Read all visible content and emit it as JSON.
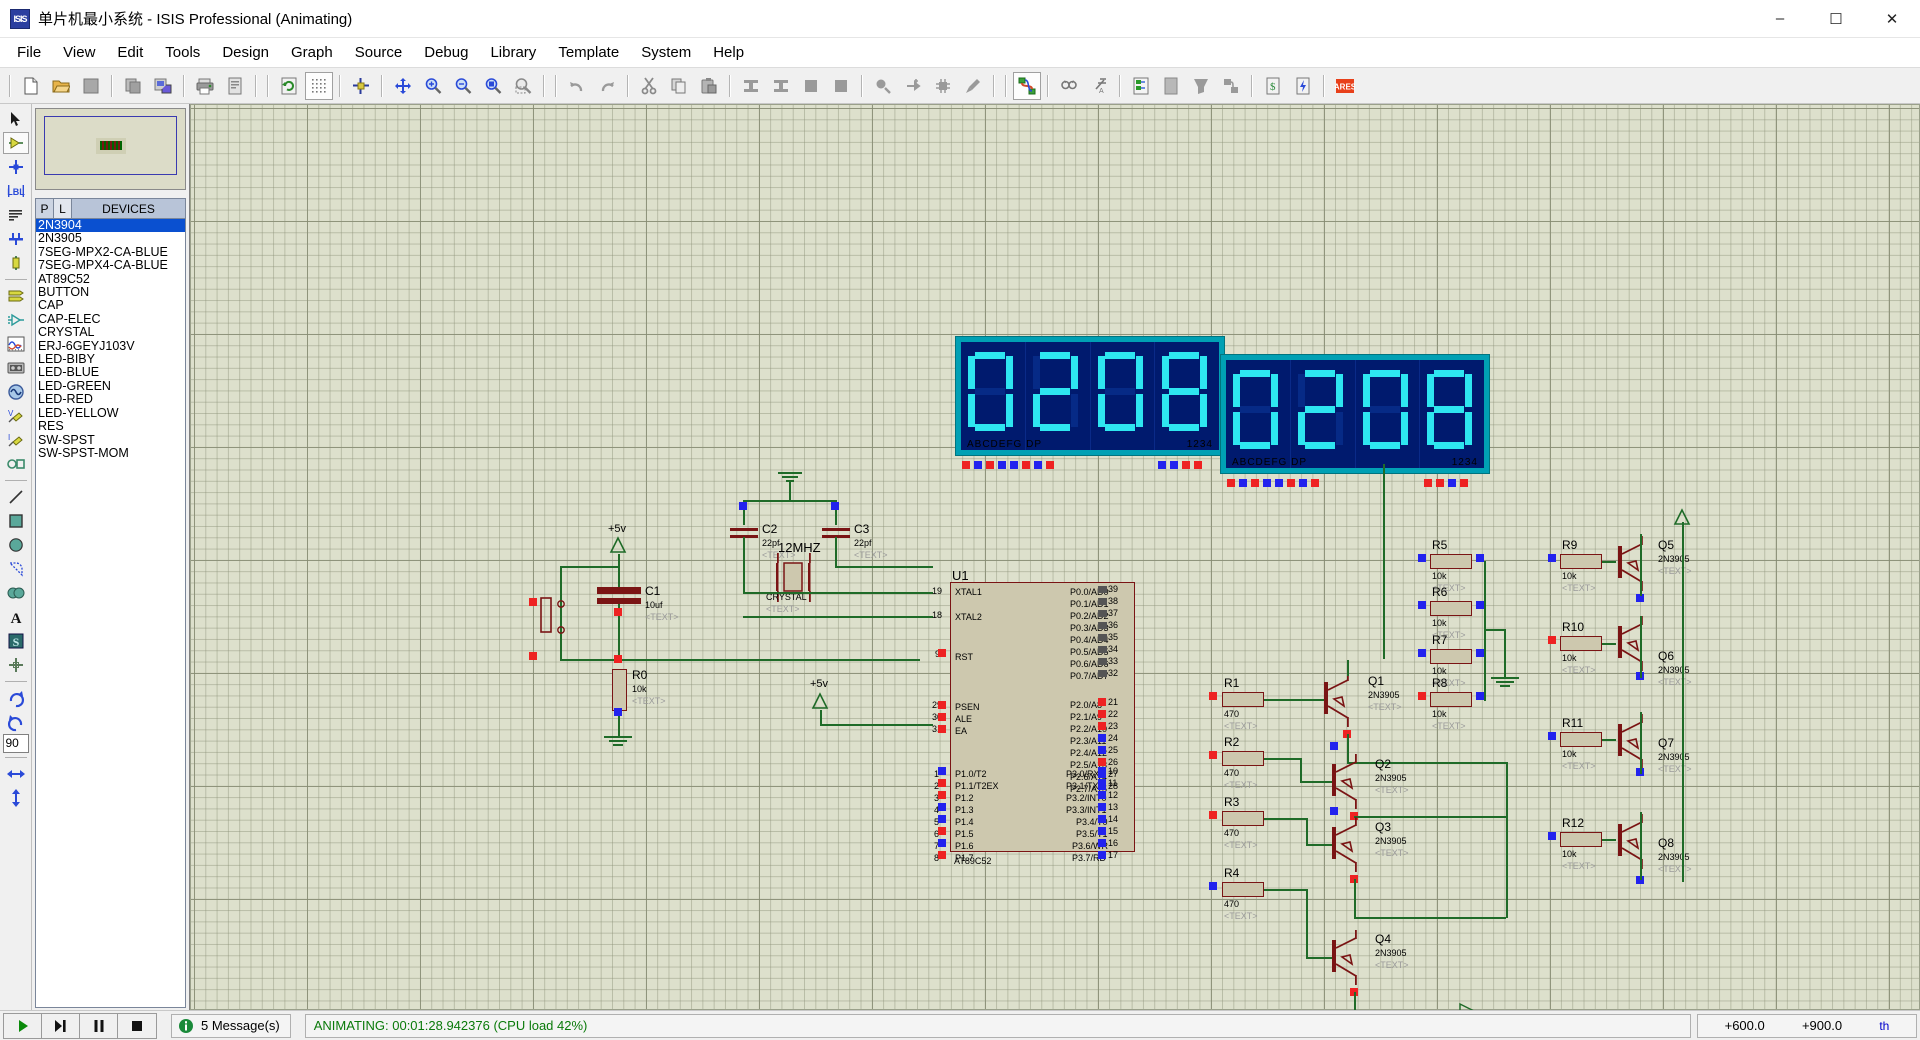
{
  "window": {
    "app_icon": "isis-icon",
    "title": "单片机最小系统 - ISIS Professional (Animating)",
    "minimize": "–",
    "maximize": "☐",
    "close": "✕"
  },
  "menubar": {
    "items": [
      {
        "label": "File",
        "name": "menu-file"
      },
      {
        "label": "View",
        "name": "menu-view"
      },
      {
        "label": "Edit",
        "name": "menu-edit"
      },
      {
        "label": "Tools",
        "name": "menu-tools"
      },
      {
        "label": "Design",
        "name": "menu-design"
      },
      {
        "label": "Graph",
        "name": "menu-graph"
      },
      {
        "label": "Source",
        "name": "menu-source"
      },
      {
        "label": "Debug",
        "name": "menu-debug"
      },
      {
        "label": "Library",
        "name": "menu-library"
      },
      {
        "label": "Template",
        "name": "menu-template"
      },
      {
        "label": "System",
        "name": "menu-system"
      },
      {
        "label": "Help",
        "name": "menu-help"
      }
    ]
  },
  "toolbar": {
    "groups": [
      [
        "new-file-icon",
        "open-file-icon",
        "save-file-icon"
      ],
      [
        "import-section-icon",
        "export-section-icon"
      ],
      [
        "print-icon",
        "print-area-icon"
      ],
      [
        "refresh-display-icon",
        "toggle-grid-icon"
      ],
      [
        "origin-icon"
      ],
      [
        "pan-icon",
        "zoom-in-icon",
        "zoom-out-icon",
        "zoom-area-icon",
        "zoom-select-icon"
      ],
      [
        "undo-icon",
        "redo-icon"
      ],
      [
        "cut-icon",
        "copy-icon",
        "paste-icon"
      ],
      [
        "block-copy-icon",
        "block-move-icon",
        "block-rotate-icon",
        "block-delete-icon"
      ],
      [
        "pick-device-icon",
        "make-device-icon",
        "package-device-icon",
        "decompose-icon"
      ],
      [
        "wire-autorouter-icon"
      ],
      [
        "search-tag-icon",
        "property-assignment-icon"
      ],
      [
        "design-explorer-icon",
        "new-sheet-icon",
        "remove-sheet-icon",
        "exit-sheet-icon"
      ],
      [
        "bill-of-materials-icon",
        "electrical-rule-check-icon"
      ],
      [
        "ares-netlist-icon"
      ]
    ]
  },
  "toolpalette": {
    "items": [
      {
        "name": "selection-mode-icon",
        "label": "Selection Mode"
      },
      {
        "name": "component-mode-icon",
        "label": "Component Mode",
        "active": true
      },
      {
        "name": "junction-dot-icon",
        "label": "Junction Dot Mode"
      },
      {
        "name": "wire-label-icon",
        "label": "Wire Label Mode"
      },
      {
        "name": "text-script-icon",
        "label": "Text Script Mode"
      },
      {
        "name": "bus-mode-icon",
        "label": "Buses Mode"
      },
      {
        "name": "subcircuit-icon",
        "label": "Subcircuit Mode"
      },
      {
        "name": "terminals-icon",
        "label": "Terminals Mode"
      },
      {
        "name": "device-pin-icon",
        "label": "Device Pins Mode"
      },
      {
        "name": "graph-mode-icon",
        "label": "Graph Mode"
      },
      {
        "name": "tape-recorder-icon",
        "label": "Tape Recorder Mode"
      },
      {
        "name": "generator-icon",
        "label": "Generator Mode"
      },
      {
        "name": "voltage-probe-icon",
        "label": "Voltage Probe Mode"
      },
      {
        "name": "current-probe-icon",
        "label": "Current Probe Mode"
      },
      {
        "name": "virtual-instrument-icon",
        "label": "Virtual Instruments Mode"
      },
      {
        "name": "line-tool-icon",
        "label": "2D Line"
      },
      {
        "name": "box-tool-icon",
        "label": "2D Box"
      },
      {
        "name": "circle-tool-icon",
        "label": "2D Circle"
      },
      {
        "name": "arc-tool-icon",
        "label": "2D Arc"
      },
      {
        "name": "path-tool-icon",
        "label": "2D Closed Path"
      },
      {
        "name": "text-tool-icon",
        "label": "2D Text"
      },
      {
        "name": "symbol-tool-icon",
        "label": "2D Symbol"
      },
      {
        "name": "marker-tool-icon",
        "label": "2D Markers"
      }
    ],
    "rotation": {
      "rotate-cw-icon": "Rotate Clockwise",
      "rotate-ccw-icon": "Rotate Anti-clockwise",
      "angle_value": "90",
      "mirror-x-icon": "Mirror Horizontally",
      "mirror-y-icon": "Mirror Vertically"
    }
  },
  "panel": {
    "preview_label": "preview-pane",
    "devices_header": {
      "p": "P",
      "l": "L",
      "title": "DEVICES"
    },
    "devices": [
      {
        "label": "2N3904",
        "selected": true
      },
      {
        "label": "2N3905",
        "selected": false
      },
      {
        "label": "7SEG-MPX2-CA-BLUE",
        "selected": false
      },
      {
        "label": "7SEG-MPX4-CA-BLUE",
        "selected": false
      },
      {
        "label": "AT89C52",
        "selected": false
      },
      {
        "label": "BUTTON",
        "selected": false
      },
      {
        "label": "CAP",
        "selected": false
      },
      {
        "label": "CAP-ELEC",
        "selected": false
      },
      {
        "label": "CRYSTAL",
        "selected": false
      },
      {
        "label": "ERJ-6GEYJ103V",
        "selected": false
      },
      {
        "label": "LED-BIBY",
        "selected": false
      },
      {
        "label": "LED-BLUE",
        "selected": false
      },
      {
        "label": "LED-GREEN",
        "selected": false
      },
      {
        "label": "LED-RED",
        "selected": false
      },
      {
        "label": "LED-YELLOW",
        "selected": false
      },
      {
        "label": "RES",
        "selected": false
      },
      {
        "label": "SW-SPST",
        "selected": false
      },
      {
        "label": "SW-SPST-MOM",
        "selected": false
      }
    ]
  },
  "schematic": {
    "displays": [
      {
        "name": "seg7-display-1",
        "digits": "0208",
        "segment_labels": "ABCDEFG  DP",
        "digit_labels": "1234"
      },
      {
        "name": "seg7-display-2",
        "digits": "0208",
        "segment_labels": "ABCDEFG  DP",
        "digit_labels": "1234"
      }
    ],
    "mcu": {
      "ref": "U1",
      "part": "AT89C52",
      "text_tag": "<TEXT>",
      "left_pins": [
        {
          "num": "19",
          "name": "XTAL1"
        },
        {
          "num": "18",
          "name": "XTAL2"
        },
        {
          "num": "9",
          "name": "RST"
        },
        {
          "num": "29",
          "name": "PSEN"
        },
        {
          "num": "30",
          "name": "ALE"
        },
        {
          "num": "31",
          "name": "EA"
        },
        {
          "num": "1",
          "name": "P1.0/T2"
        },
        {
          "num": "2",
          "name": "P1.1/T2EX"
        },
        {
          "num": "3",
          "name": "P1.2"
        },
        {
          "num": "4",
          "name": "P1.3"
        },
        {
          "num": "5",
          "name": "P1.4"
        },
        {
          "num": "6",
          "name": "P1.5"
        },
        {
          "num": "7",
          "name": "P1.6"
        },
        {
          "num": "8",
          "name": "P1.7"
        }
      ],
      "right_pins_p0": [
        {
          "num": "39",
          "name": "P0.0/AD0"
        },
        {
          "num": "38",
          "name": "P0.1/AD1"
        },
        {
          "num": "37",
          "name": "P0.2/AD2"
        },
        {
          "num": "36",
          "name": "P0.3/AD3"
        },
        {
          "num": "35",
          "name": "P0.4/AD4"
        },
        {
          "num": "34",
          "name": "P0.5/AD5"
        },
        {
          "num": "33",
          "name": "P0.6/AD6"
        },
        {
          "num": "32",
          "name": "P0.7/AD7"
        }
      ],
      "right_pins_p2": [
        {
          "num": "21",
          "name": "P2.0/A8"
        },
        {
          "num": "22",
          "name": "P2.1/A9"
        },
        {
          "num": "23",
          "name": "P2.2/A10"
        },
        {
          "num": "24",
          "name": "P2.3/A11"
        },
        {
          "num": "25",
          "name": "P2.4/A12"
        },
        {
          "num": "26",
          "name": "P2.5/A13"
        },
        {
          "num": "27",
          "name": "P2.6/A14"
        },
        {
          "num": "28",
          "name": "P2.7/A15"
        }
      ],
      "right_pins_p3": [
        {
          "num": "10",
          "name": "P3.0/RXD"
        },
        {
          "num": "11",
          "name": "P3.1/TXD"
        },
        {
          "num": "12",
          "name": "P3.2/INT0"
        },
        {
          "num": "13",
          "name": "P3.3/INT1"
        },
        {
          "num": "14",
          "name": "P3.4/T0"
        },
        {
          "num": "15",
          "name": "P3.5/T1"
        },
        {
          "num": "16",
          "name": "P3.6/WR"
        },
        {
          "num": "17",
          "name": "P3.7/RD"
        }
      ]
    },
    "power_labels": [
      "+5v",
      "+5v"
    ],
    "components": [
      {
        "ref": "C1",
        "value": "10uf",
        "tag": "<TEXT>",
        "type": "cap-elec"
      },
      {
        "ref": "R0",
        "value": "10k",
        "tag": "<TEXT>",
        "type": "res"
      },
      {
        "ref": "C2",
        "value": "22pf",
        "tag": "<TEXT>",
        "type": "cap"
      },
      {
        "ref": "C3",
        "value": "22pf",
        "tag": "<TEXT>",
        "type": "cap"
      },
      {
        "ref": "CRYSTAL",
        "value": "12MHZ",
        "tag": "<TEXT>",
        "type": "crystal"
      },
      {
        "ref": "R1",
        "value": "470",
        "tag": "<TEXT>",
        "type": "res"
      },
      {
        "ref": "R2",
        "value": "470",
        "tag": "<TEXT>",
        "type": "res"
      },
      {
        "ref": "R3",
        "value": "470",
        "tag": "<TEXT>",
        "type": "res"
      },
      {
        "ref": "R4",
        "value": "470",
        "tag": "<TEXT>",
        "type": "res"
      },
      {
        "ref": "R5",
        "value": "10k",
        "tag": "<TEXT>",
        "type": "res"
      },
      {
        "ref": "R6",
        "value": "10k",
        "tag": "<TEXT>",
        "type": "res"
      },
      {
        "ref": "R7",
        "value": "10k",
        "tag": "<TEXT>",
        "type": "res"
      },
      {
        "ref": "R8",
        "value": "10k",
        "tag": "<TEXT>",
        "type": "res"
      },
      {
        "ref": "R9",
        "value": "10k",
        "tag": "<TEXT>",
        "type": "res"
      },
      {
        "ref": "R10",
        "value": "10k",
        "tag": "<TEXT>",
        "type": "res"
      },
      {
        "ref": "R11",
        "value": "10k",
        "tag": "<TEXT>",
        "type": "res"
      },
      {
        "ref": "R12",
        "value": "10k",
        "tag": "<TEXT>",
        "type": "res"
      },
      {
        "ref": "Q1",
        "value": "2N3905",
        "tag": "<TEXT>",
        "type": "pnp"
      },
      {
        "ref": "Q2",
        "value": "2N3905",
        "tag": "<TEXT>",
        "type": "pnp"
      },
      {
        "ref": "Q3",
        "value": "2N3905",
        "tag": "<TEXT>",
        "type": "pnp"
      },
      {
        "ref": "Q4",
        "value": "2N3905",
        "tag": "<TEXT>",
        "type": "pnp"
      },
      {
        "ref": "Q5",
        "value": "2N3905",
        "tag": "<TEXT>",
        "type": "pnp"
      },
      {
        "ref": "Q6",
        "value": "2N3905",
        "tag": "<TEXT>",
        "type": "pnp"
      },
      {
        "ref": "Q7",
        "value": "2N3905",
        "tag": "<TEXT>",
        "type": "pnp"
      },
      {
        "ref": "Q8",
        "value": "2N3905",
        "tag": "<TEXT>",
        "type": "pnp"
      }
    ]
  },
  "statusbar": {
    "play_button": "play-icon",
    "step_button": "step-icon",
    "pause_button": "pause-icon",
    "stop_button": "stop-icon",
    "message_icon": "info-icon",
    "messages": "5 Message(s)",
    "animation_status": "ANIMATING: 00:01:28.942376 (CPU load 42%)",
    "coord_x": "+600.0",
    "coord_y": "+900.0",
    "coord_unit": "th"
  },
  "colors": {
    "canvas_bg": "#dde0cc",
    "wire_green": "#1f6b28",
    "component_red": "#7a1414",
    "selection_blue": "#0a50d0",
    "display_bezel": "#00a0b4",
    "display_face": "#001a6e",
    "segment_on": "#2ee6f0",
    "status_green": "#0a7a0a"
  }
}
